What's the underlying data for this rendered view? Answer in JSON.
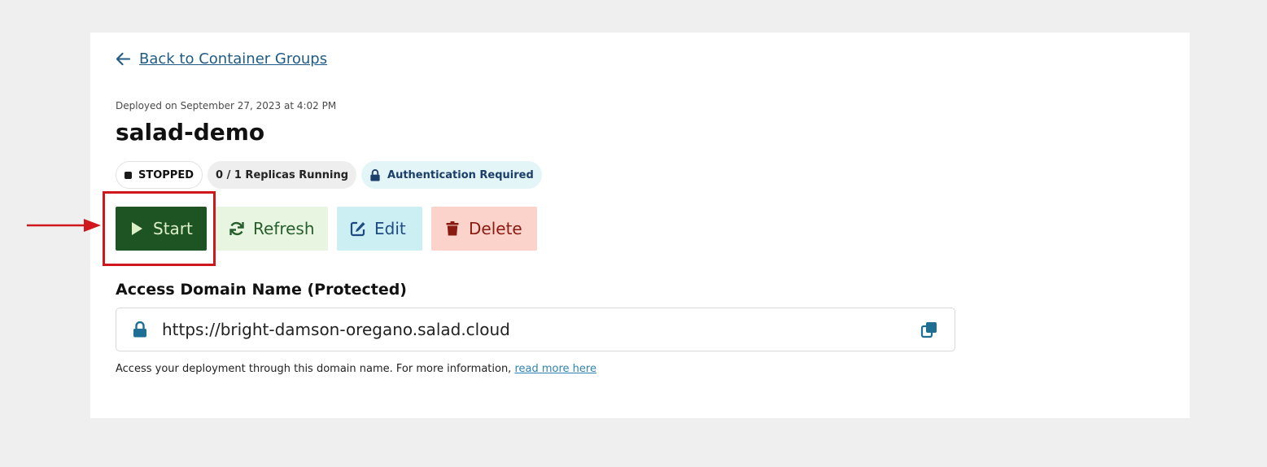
{
  "back_link": {
    "label": "Back to Container Groups"
  },
  "deployed_text": "Deployed on September 27, 2023 at 4:02 PM",
  "title": "salad-demo",
  "badges": {
    "status": "STOPPED",
    "replicas": "0 / 1 Replicas Running",
    "auth": "Authentication Required"
  },
  "actions": {
    "start": "Start",
    "refresh": "Refresh",
    "edit": "Edit",
    "delete": "Delete"
  },
  "domain": {
    "label": "Access Domain Name (Protected)",
    "url": "https://bright-damson-oregano.salad.cloud",
    "help_text": "Access your deployment through this domain name. For more information, ",
    "help_link": "read more here"
  },
  "icons": {
    "back": "arrow-left-icon",
    "status": "stop-square-icon",
    "auth": "lock-icon",
    "start": "play-icon",
    "refresh": "refresh-icon",
    "edit": "edit-icon",
    "delete": "trash-icon",
    "domain_lock": "lock-icon",
    "copy": "copy-icon"
  },
  "colors": {
    "start_bg": "#1e5324",
    "refresh_bg": "#e8f6e1",
    "edit_bg": "#cceff3",
    "delete_bg": "#fbd3cb",
    "annotation_red": "#d0171c"
  }
}
